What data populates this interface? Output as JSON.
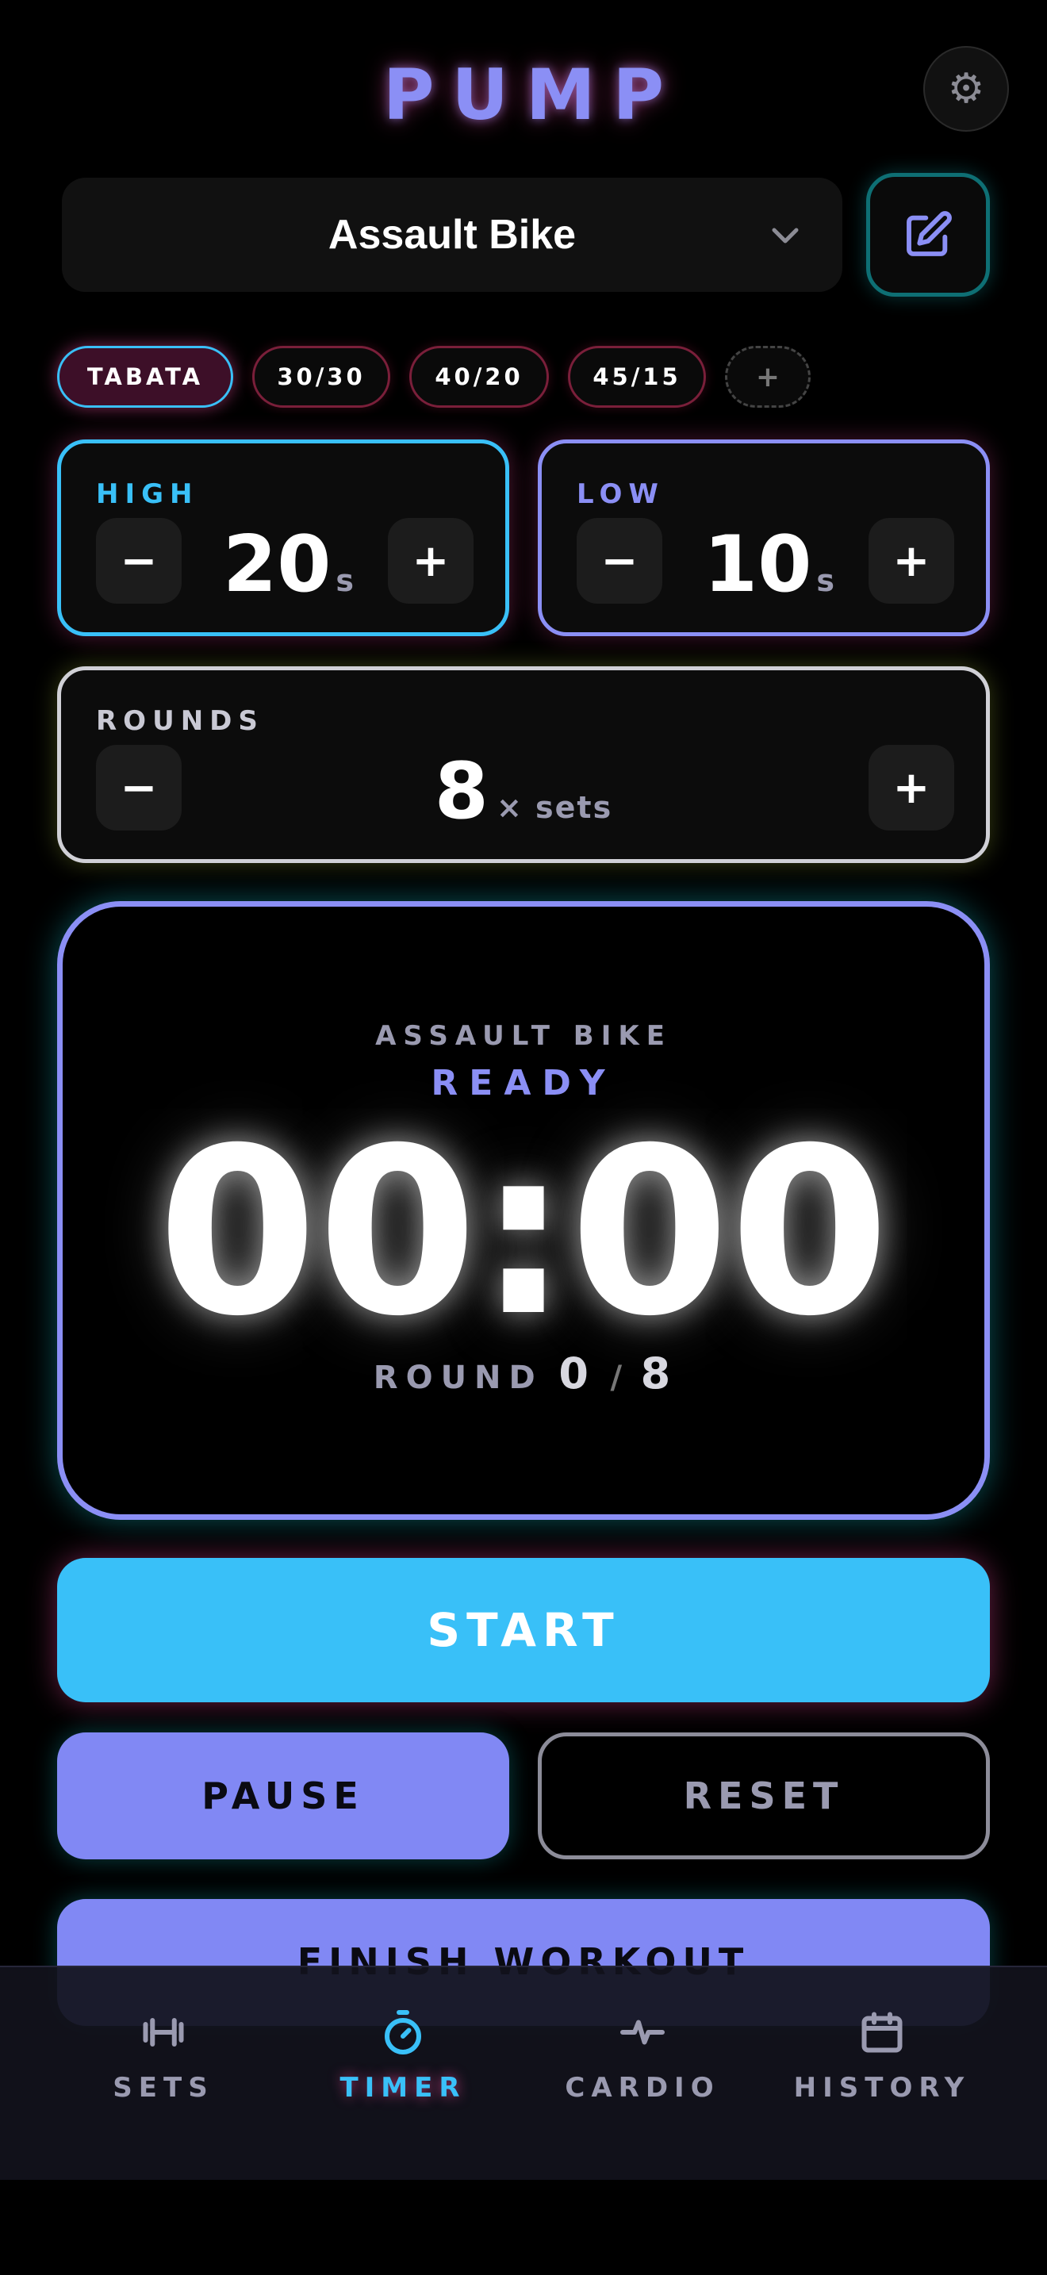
{
  "header": {
    "title": "PUMP",
    "settings_icon": "gear-icon",
    "settings_glyph": "⚙"
  },
  "exercise": {
    "selected": "Assault Bike",
    "dropdown_icon": "chevron-down-icon",
    "edit_icon": "edit-icon"
  },
  "presets": [
    {
      "label": "TABATA",
      "active": true
    },
    {
      "label": "30/30",
      "active": false
    },
    {
      "label": "40/20",
      "active": false
    },
    {
      "label": "45/15",
      "active": false
    }
  ],
  "add_preset_label": "+",
  "high": {
    "label": "HIGH",
    "value": "20",
    "unit": "s",
    "minus": "−",
    "plus": "+"
  },
  "low": {
    "label": "LOW",
    "value": "10",
    "unit": "s",
    "minus": "−",
    "plus": "+"
  },
  "rounds": {
    "label": "ROUNDS",
    "value": "8",
    "unit": "× sets",
    "minus": "−",
    "plus": "+"
  },
  "timer": {
    "exercise": "ASSAULT BIKE",
    "status": "READY",
    "time": "00:00",
    "round_label": "ROUND",
    "round_current": "0",
    "round_separator": "/",
    "round_total": "8"
  },
  "actions": {
    "start": "START",
    "pause": "PAUSE",
    "reset": "RESET",
    "finish": "FINISH WORKOUT"
  },
  "nav": [
    {
      "label": "SETS",
      "icon": "dumbbell-icon",
      "active": false
    },
    {
      "label": "TIMER",
      "icon": "stopwatch-icon",
      "active": true
    },
    {
      "label": "CARDIO",
      "icon": "pulse-icon",
      "active": false
    },
    {
      "label": "HISTORY",
      "icon": "calendar-icon",
      "active": false
    }
  ],
  "colors": {
    "accent": "#8b8ff5",
    "cyan": "#39c0f8",
    "violet": "#8188f4",
    "pink_glow": "#ec4899",
    "teal": "#0e6f74"
  }
}
